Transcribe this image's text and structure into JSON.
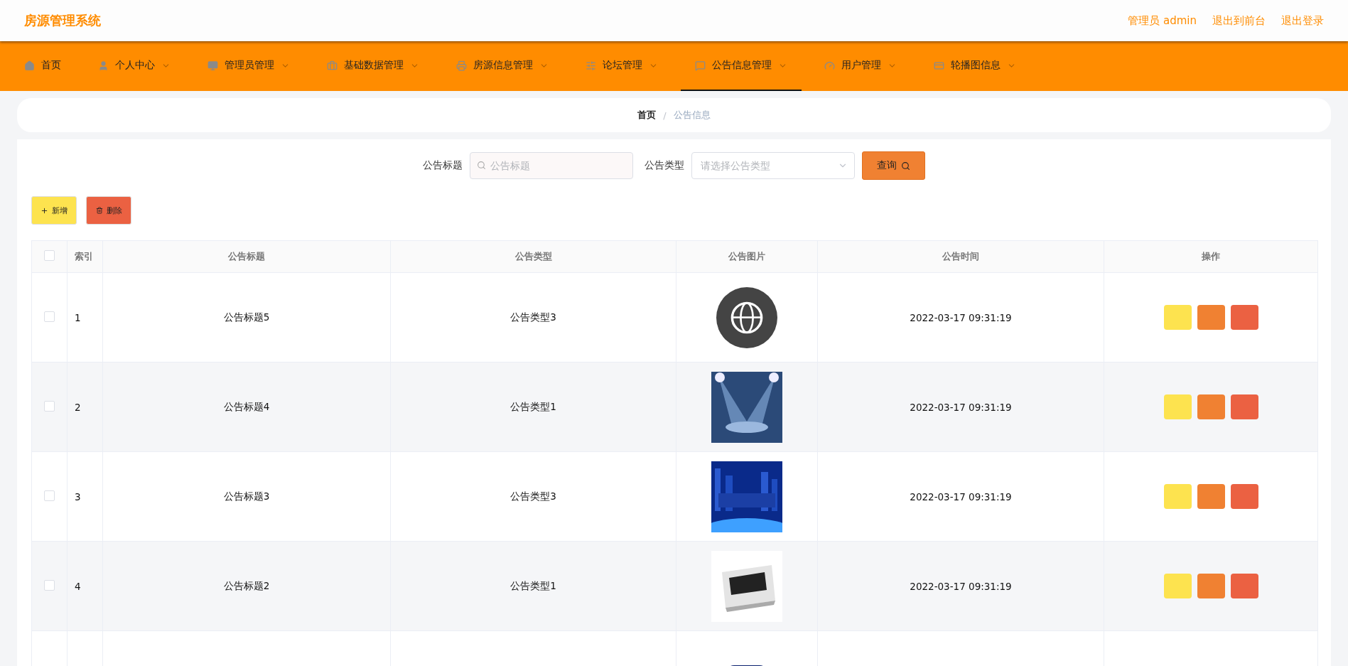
{
  "header": {
    "title": "房源管理系统",
    "links": [
      "管理员 admin",
      "退出到前台",
      "退出登录"
    ]
  },
  "nav": [
    {
      "label": "首页",
      "dropdown": false,
      "selected": false
    },
    {
      "label": "个人中心",
      "dropdown": true,
      "selected": false
    },
    {
      "label": "管理员管理",
      "dropdown": true,
      "selected": false
    },
    {
      "label": "基础数据管理",
      "dropdown": true,
      "selected": false
    },
    {
      "label": "房源信息管理",
      "dropdown": true,
      "selected": false
    },
    {
      "label": "论坛管理",
      "dropdown": true,
      "selected": false
    },
    {
      "label": "公告信息管理",
      "dropdown": true,
      "selected": true
    },
    {
      "label": "用户管理",
      "dropdown": true,
      "selected": false
    },
    {
      "label": "轮播图信息",
      "dropdown": true,
      "selected": false
    }
  ],
  "breadcrumb": {
    "items": [
      "首页",
      "公告信息"
    ],
    "separator": "/"
  },
  "search": {
    "fields": [
      {
        "label": "公告标题",
        "kind": "text",
        "placeholder": "公告标题"
      },
      {
        "label": "公告类型",
        "kind": "select",
        "placeholder": "请选择公告类型"
      }
    ],
    "button": "查询"
  },
  "actions": [
    {
      "label": "新增",
      "kind": "add"
    },
    {
      "label": "删除",
      "kind": "delete"
    }
  ],
  "table": {
    "select_all": {
      "checked": false
    },
    "columns": [
      "索引",
      "公告标题",
      "公告类型",
      "公告图片",
      "公告时间",
      "操作"
    ],
    "rows": [
      {
        "checked": false,
        "index": "1",
        "title": "公告标题5",
        "type": "公告类型3",
        "image": {
          "kind": "picture"
        },
        "time": "2022-03-17 09:31:19"
      },
      {
        "checked": false,
        "index": "2",
        "title": "公告标题4",
        "type": "公告类型1",
        "image": {
          "kind": "picture"
        },
        "time": "2022-03-17 09:31:19"
      },
      {
        "checked": false,
        "index": "3",
        "title": "公告标题3",
        "type": "公告类型3",
        "image": {
          "kind": "picture"
        },
        "time": "2022-03-17 09:31:19"
      },
      {
        "checked": false,
        "index": "4",
        "title": "公告标题2",
        "type": "公告类型1",
        "image": {
          "kind": "picture"
        },
        "time": "2022-03-17 09:31:19"
      },
      {
        "image": {
          "kind": "picture"
        }
      }
    ]
  }
}
